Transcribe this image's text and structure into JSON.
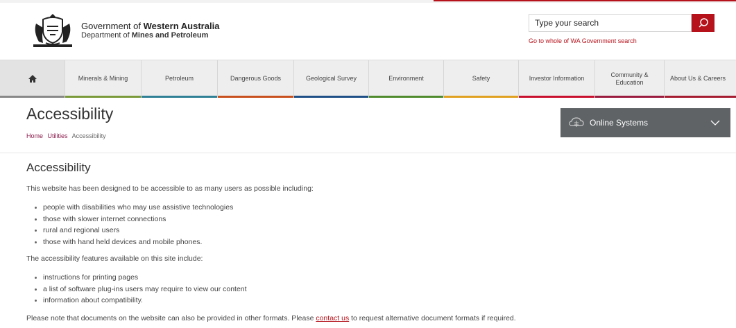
{
  "header": {
    "gov_prefix": "Government of ",
    "gov_bold": "Western Australia",
    "dept_prefix": "Department of ",
    "dept_bold": "Mines and Petroleum",
    "search_placeholder": "Type your search",
    "whole_gov_link": "Go to whole of WA Government search"
  },
  "nav": {
    "items": [
      {
        "label": "Minerals & Mining",
        "color": "#7a9a3a"
      },
      {
        "label": "Petroleum",
        "color": "#2f7f95"
      },
      {
        "label": "Dangerous Goods",
        "color": "#c8501e"
      },
      {
        "label": "Geological Survey",
        "color": "#1e4f86"
      },
      {
        "label": "Environment",
        "color": "#4f8a2c"
      },
      {
        "label": "Safety",
        "color": "#e0a020"
      },
      {
        "label": "Investor Information",
        "color": "#c8102e"
      },
      {
        "label": "Community & Education",
        "color": "#9a1b3e"
      },
      {
        "label": "About Us & Careers",
        "color": "#a51c30"
      }
    ]
  },
  "page": {
    "title": "Accessibility",
    "breadcrumb": [
      "Home",
      "Utilities",
      "Accessibility"
    ],
    "online_systems": "Online Systems"
  },
  "content": {
    "heading": "Accessibility",
    "intro": "This website has been designed to be accessible to as many users as possible including:",
    "users": [
      "people with disabilities who may use assistive technologies",
      "those with slower internet connections",
      "rural and regional users",
      "those with hand held devices and mobile phones."
    ],
    "features_intro": "The accessibility features available on this site include:",
    "features": [
      "instructions for printing pages",
      "a list of software plug-ins users may require to view our content",
      "information about compatibility."
    ],
    "note_before": "Please note that documents on the website can also be provided in other formats. Please ",
    "note_link": "contact us",
    "note_after": " to request alternative document formats if required."
  },
  "colors": {
    "accent": "#b5121b",
    "online_systems_bg": "#5f6366"
  }
}
